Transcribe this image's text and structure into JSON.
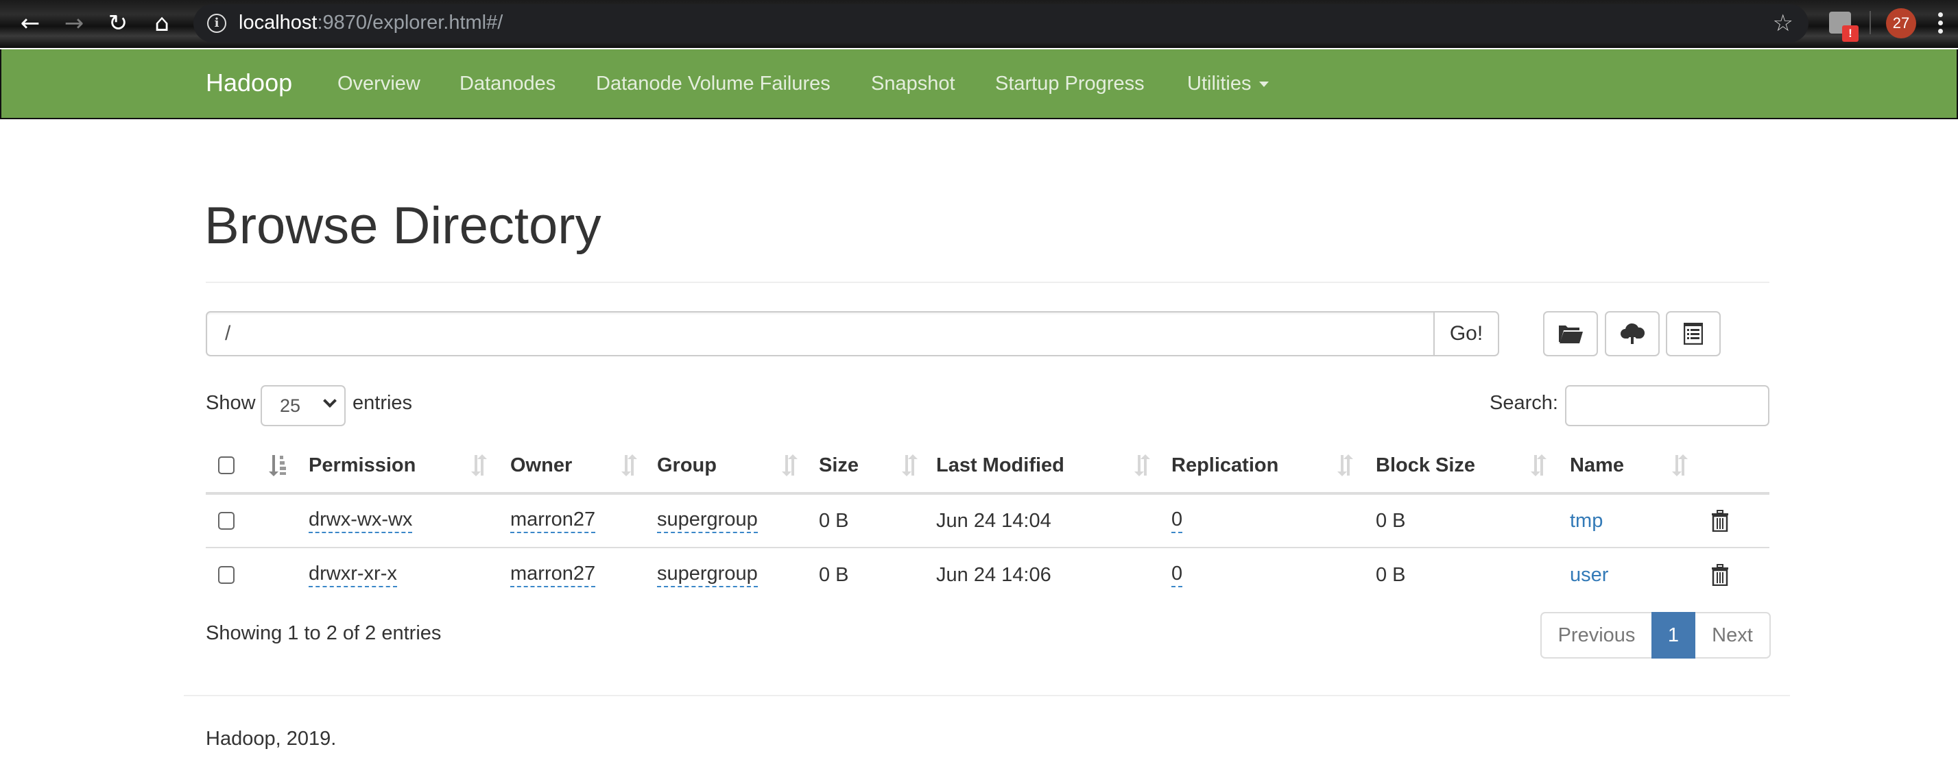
{
  "browser": {
    "back_icon": "arrow-left",
    "forward_icon": "arrow-right",
    "reload_icon": "reload",
    "home_icon": "home",
    "url_host": "localhost",
    "url_rest": ":9870/explorer.html#/",
    "bookmark_icon": "star",
    "extension_badge": "!",
    "profile_badge": "27"
  },
  "navbar": {
    "brand": "Hadoop",
    "items": [
      {
        "label": "Overview"
      },
      {
        "label": "Datanodes"
      },
      {
        "label": "Datanode Volume Failures"
      },
      {
        "label": "Snapshot"
      },
      {
        "label": "Startup Progress"
      },
      {
        "label": "Utilities",
        "dropdown": true
      }
    ],
    "color": "#6ea14c"
  },
  "page": {
    "title": "Browse Directory",
    "path_value": "/",
    "go_label": "Go!",
    "toolbar": [
      {
        "name": "create-directory",
        "icon": "folder-open-icon"
      },
      {
        "name": "upload-files",
        "icon": "cloud-upload-icon"
      },
      {
        "name": "cut-paste-list",
        "icon": "list-alt-icon"
      }
    ]
  },
  "table_controls": {
    "show_label": "Show",
    "entries_label": "entries",
    "page_length": "25",
    "search_label": "Search:",
    "search_value": ""
  },
  "table": {
    "columns": [
      "Permission",
      "Owner",
      "Group",
      "Size",
      "Last Modified",
      "Replication",
      "Block Size",
      "Name"
    ],
    "rows": [
      {
        "permission": "drwx-wx-wx",
        "owner": "marron27",
        "group": "supergroup",
        "size": "0 B",
        "last_modified": "Jun 24 14:04",
        "replication": "0",
        "block_size": "0 B",
        "name": "tmp"
      },
      {
        "permission": "drwxr-xr-x",
        "owner": "marron27",
        "group": "supergroup",
        "size": "0 B",
        "last_modified": "Jun 24 14:06",
        "replication": "0",
        "block_size": "0 B",
        "name": "user"
      }
    ]
  },
  "pagination": {
    "info": "Showing 1 to 2 of 2 entries",
    "previous": "Previous",
    "current": "1",
    "next": "Next",
    "active_color": "#4479b1"
  },
  "footer": {
    "text": "Hadoop, 2019."
  },
  "colors": {
    "link": "#337ab7"
  }
}
